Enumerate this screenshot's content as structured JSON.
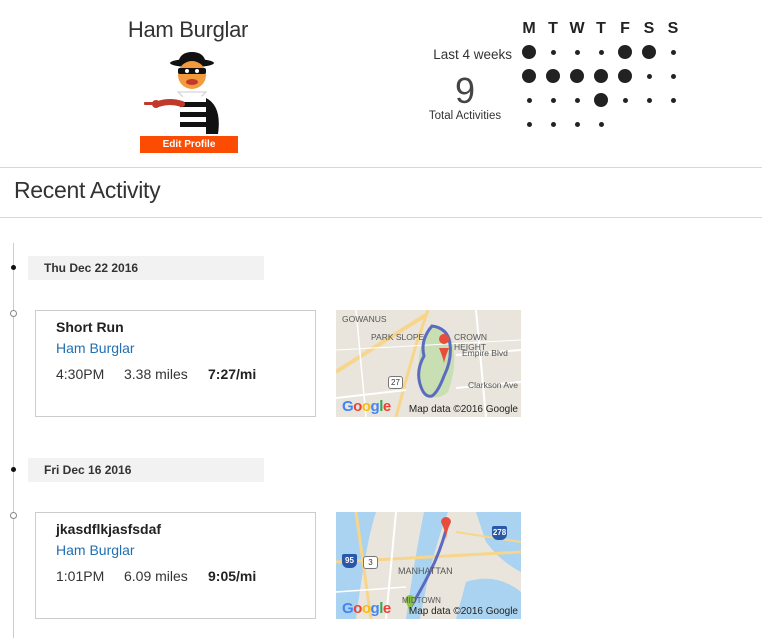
{
  "profile": {
    "name": "Ham Burglar",
    "edit_label": "Edit Profile"
  },
  "stats": {
    "period_label": "Last 4 weeks",
    "total_count": "9",
    "total_label": "Total Activities",
    "days": [
      "M",
      "T",
      "W",
      "T",
      "F",
      "S",
      "S"
    ],
    "weeks": [
      [
        "big",
        "small",
        "small",
        "small",
        "big",
        "big",
        "small"
      ],
      [
        "big",
        "big",
        "big",
        "big",
        "big",
        "small",
        "small"
      ],
      [
        "small",
        "small",
        "small",
        "big",
        "small",
        "small",
        "small"
      ],
      [
        "small",
        "small",
        "small",
        "small",
        "none",
        "none",
        "none"
      ]
    ]
  },
  "recent": {
    "title": "Recent Activity"
  },
  "activities": [
    {
      "date": "Thu Dec 22 2016",
      "title": "Short Run",
      "athlete": "Ham Burglar",
      "time": "4:30PM",
      "distance": "3.38 miles",
      "pace": "7:27/mi",
      "map": {
        "credit": "Map data ©2016 Google",
        "logo": "Google",
        "labels": [
          "GOWANUS",
          "PARK SLOPE",
          "CROWN HEIGHT",
          "Empire Blvd",
          "Clarkson Ave"
        ],
        "shield": "27"
      }
    },
    {
      "date": "Fri Dec 16 2016",
      "title": "jkasdflkjasfsdaf",
      "athlete": "Ham Burglar",
      "time": "1:01PM",
      "distance": "6.09 miles",
      "pace": "9:05/mi",
      "map": {
        "credit": "Map data ©2016 Google",
        "logo": "Google",
        "labels": [
          "MANHATTAN",
          "MIDTOWN"
        ],
        "shields": [
          "95",
          "3",
          "278"
        ]
      }
    }
  ],
  "colors": {
    "accent": "#fc4c02",
    "link": "#1f6fb2",
    "route": "#5c6bc0"
  }
}
